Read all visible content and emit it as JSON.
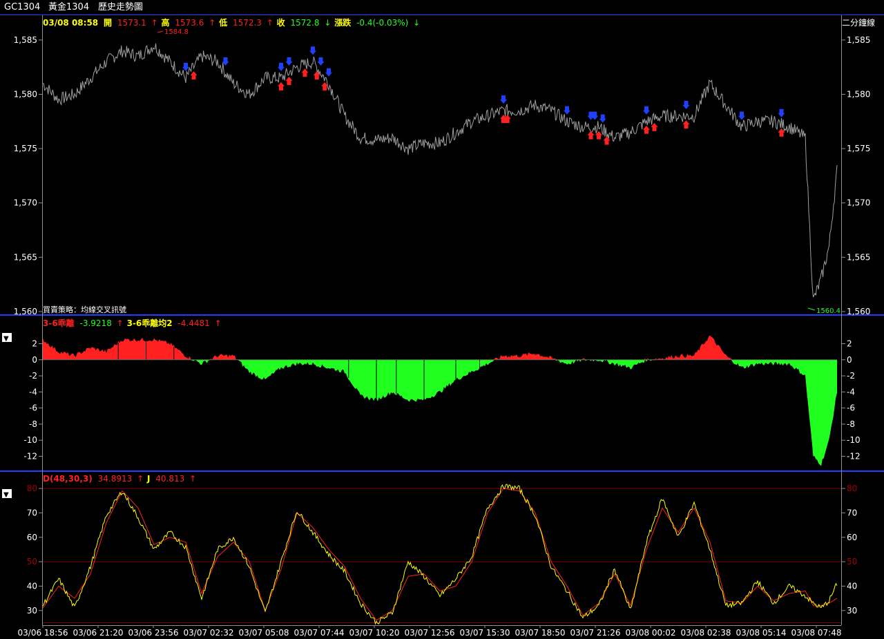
{
  "window": {
    "symbol": "GC1304",
    "name": "黃金1304",
    "view": "歷史走勢圖"
  },
  "colors": {
    "up": "#ff2020",
    "down": "#20ff20",
    "label_yellow": "#ffff00",
    "price_line": "#a0a0a0",
    "border": "#2040ff",
    "buy_marker": "#ff2020",
    "sell_marker": "#2040ff",
    "grid_red": "#800000"
  },
  "price_panel": {
    "header": {
      "datetime": "03/08 08:58",
      "open_label": "開",
      "open": "1573.1",
      "open_arrow": "↑",
      "high_label": "高",
      "high": "1573.6",
      "high_arrow": "↑",
      "low_label": "低",
      "low": "1572.3",
      "low_arrow": "↑",
      "close_label": "收",
      "close": "1572.8",
      "close_arrow": "↓",
      "change_label": "漲跌",
      "change": "-0.4(-0.03%)",
      "change_arrow": "↓"
    },
    "period_label": "二分鐘線",
    "strategy_label": "買賣策略：均線交叉訊號",
    "max_label": "1584.8",
    "min_label": "1560.4"
  },
  "osc_panel": {
    "collapse_glyph": "▼",
    "label1": "3-6乖離",
    "value1": "-3.9218",
    "arrow1": "↑",
    "label2": "3-6乖離均2",
    "value2": "-4.4481",
    "arrow2": "↑"
  },
  "kd_panel": {
    "collapse_glyph": "▼",
    "label1": "D(48,30,3)",
    "value1": "34.8913",
    "arrow1": "↑",
    "label2": "J",
    "value2": "40.813",
    "arrow2": "↑"
  },
  "chart_data": [
    {
      "type": "line",
      "name": "price",
      "x_ticks": [
        "03/06 18:56",
        "03/06 21:20",
        "03/06 23:56",
        "03/07 02:32",
        "03/07 05:08",
        "03/07 07:44",
        "03/07 10:20",
        "03/07 12:56",
        "03/07 15:30",
        "03/07 18:50",
        "03/07 21:26",
        "03/08 00:02",
        "03/08 02:38",
        "03/08 05:14",
        "03/08 07:48"
      ],
      "ylim": [
        1560,
        1585.5
      ],
      "y_ticks": [
        1560,
        1565,
        1570,
        1575,
        1580,
        1585
      ],
      "y_tick_labels": [
        "1,560",
        "1,565",
        "1,570",
        "1,575",
        "1,580",
        "1,585"
      ],
      "x": [
        0,
        0.02,
        0.04,
        0.06,
        0.08,
        0.1,
        0.12,
        0.14,
        0.16,
        0.18,
        0.2,
        0.22,
        0.24,
        0.26,
        0.28,
        0.3,
        0.32,
        0.34,
        0.36,
        0.38,
        0.4,
        0.42,
        0.44,
        0.46,
        0.48,
        0.5,
        0.52,
        0.54,
        0.56,
        0.58,
        0.6,
        0.62,
        0.64,
        0.66,
        0.68,
        0.7,
        0.72,
        0.74,
        0.76,
        0.78,
        0.8,
        0.82,
        0.84,
        0.86,
        0.88,
        0.9,
        0.92,
        0.94,
        0.96,
        0.97,
        0.98,
        0.99,
        1.0
      ],
      "values": [
        1581,
        1579.5,
        1580,
        1581.5,
        1583,
        1584,
        1583.5,
        1584.5,
        1583,
        1581.5,
        1583.5,
        1583,
        1581,
        1580,
        1581.5,
        1581.5,
        1582.5,
        1583,
        1581,
        1578,
        1576,
        1575.8,
        1576,
        1575,
        1575.5,
        1575.5,
        1576.5,
        1577.5,
        1578,
        1578.5,
        1578.5,
        1579,
        1578.5,
        1577.5,
        1577,
        1577,
        1576,
        1576.5,
        1577.5,
        1578,
        1578,
        1578,
        1581,
        1579,
        1577,
        1577.5,
        1577.5,
        1577,
        1576,
        1561,
        1563,
        1566,
        1573
      ]
    },
    {
      "type": "area",
      "name": "3-6乖離",
      "ylim": [
        -13.5,
        3.5
      ],
      "y_ticks": [
        2,
        0,
        -2,
        -4,
        -6,
        -8,
        -10,
        -12
      ],
      "x": [
        0,
        0.02,
        0.04,
        0.06,
        0.08,
        0.1,
        0.12,
        0.14,
        0.16,
        0.18,
        0.2,
        0.22,
        0.24,
        0.26,
        0.28,
        0.3,
        0.32,
        0.34,
        0.36,
        0.38,
        0.4,
        0.42,
        0.44,
        0.46,
        0.48,
        0.5,
        0.52,
        0.54,
        0.56,
        0.58,
        0.6,
        0.62,
        0.64,
        0.66,
        0.68,
        0.7,
        0.72,
        0.74,
        0.76,
        0.78,
        0.8,
        0.82,
        0.84,
        0.86,
        0.88,
        0.9,
        0.92,
        0.94,
        0.96,
        0.97,
        0.98,
        0.99,
        1.0
      ],
      "values": [
        2.5,
        1.0,
        0.5,
        1.5,
        1.0,
        2.5,
        2.5,
        2.5,
        2.0,
        0.5,
        -0.5,
        0.5,
        0.5,
        -1.5,
        -2.5,
        -1.0,
        -0.5,
        -0.5,
        -1.0,
        -1.5,
        -4.5,
        -5.0,
        -4.0,
        -5.0,
        -5.0,
        -4.0,
        -2.5,
        -1.5,
        -0.5,
        0.5,
        0.5,
        0.8,
        0.2,
        -0.5,
        0,
        0,
        -0.5,
        -1.0,
        0,
        0.2,
        0.5,
        0.5,
        3.0,
        0.5,
        -1.0,
        -0.5,
        -0.5,
        -0.5,
        -2.0,
        -12.0,
        -13.0,
        -10.0,
        -4.0
      ]
    },
    {
      "type": "line",
      "name": "D(48,30,3)",
      "ylim": [
        24,
        82
      ],
      "y_ticks": [
        30,
        40,
        50,
        60,
        70,
        80
      ],
      "grid_red": [
        25,
        50,
        80
      ],
      "x": [
        0,
        0.02,
        0.04,
        0.06,
        0.08,
        0.1,
        0.12,
        0.14,
        0.16,
        0.18,
        0.2,
        0.22,
        0.24,
        0.26,
        0.28,
        0.3,
        0.32,
        0.34,
        0.36,
        0.38,
        0.4,
        0.42,
        0.44,
        0.46,
        0.48,
        0.5,
        0.52,
        0.54,
        0.56,
        0.58,
        0.6,
        0.62,
        0.64,
        0.66,
        0.68,
        0.7,
        0.72,
        0.74,
        0.76,
        0.78,
        0.8,
        0.82,
        0.84,
        0.86,
        0.88,
        0.9,
        0.92,
        0.94,
        0.96,
        0.97,
        0.98,
        0.99,
        1.0
      ],
      "values": [
        31,
        40,
        35,
        45,
        66,
        79,
        72,
        57,
        60,
        58,
        37,
        52,
        58,
        50,
        30,
        47,
        70,
        64,
        55,
        48,
        35,
        26,
        30,
        44,
        45,
        38,
        40,
        50,
        70,
        80,
        79,
        70,
        50,
        40,
        28,
        33,
        45,
        32,
        55,
        72,
        62,
        72,
        58,
        34,
        33,
        40,
        34,
        37,
        38,
        32,
        32,
        33,
        35
      ]
    },
    {
      "type": "line",
      "name": "J",
      "x": [
        0,
        0.02,
        0.04,
        0.06,
        0.08,
        0.1,
        0.12,
        0.14,
        0.16,
        0.18,
        0.2,
        0.22,
        0.24,
        0.26,
        0.28,
        0.3,
        0.32,
        0.34,
        0.36,
        0.38,
        0.4,
        0.42,
        0.44,
        0.46,
        0.48,
        0.5,
        0.52,
        0.54,
        0.56,
        0.58,
        0.6,
        0.62,
        0.64,
        0.66,
        0.68,
        0.7,
        0.72,
        0.74,
        0.76,
        0.78,
        0.8,
        0.82,
        0.84,
        0.86,
        0.88,
        0.9,
        0.92,
        0.94,
        0.96,
        0.97,
        0.98,
        0.99,
        1.0
      ],
      "values": [
        32,
        43,
        31,
        48,
        69,
        79,
        68,
        55,
        62,
        56,
        35,
        55,
        60,
        48,
        29,
        50,
        71,
        62,
        53,
        46,
        33,
        25,
        29,
        50,
        44,
        36,
        43,
        52,
        72,
        81,
        80,
        69,
        48,
        38,
        27,
        32,
        47,
        30,
        58,
        76,
        60,
        74,
        55,
        32,
        33,
        42,
        33,
        40,
        36,
        33,
        31,
        34,
        41
      ]
    }
  ]
}
